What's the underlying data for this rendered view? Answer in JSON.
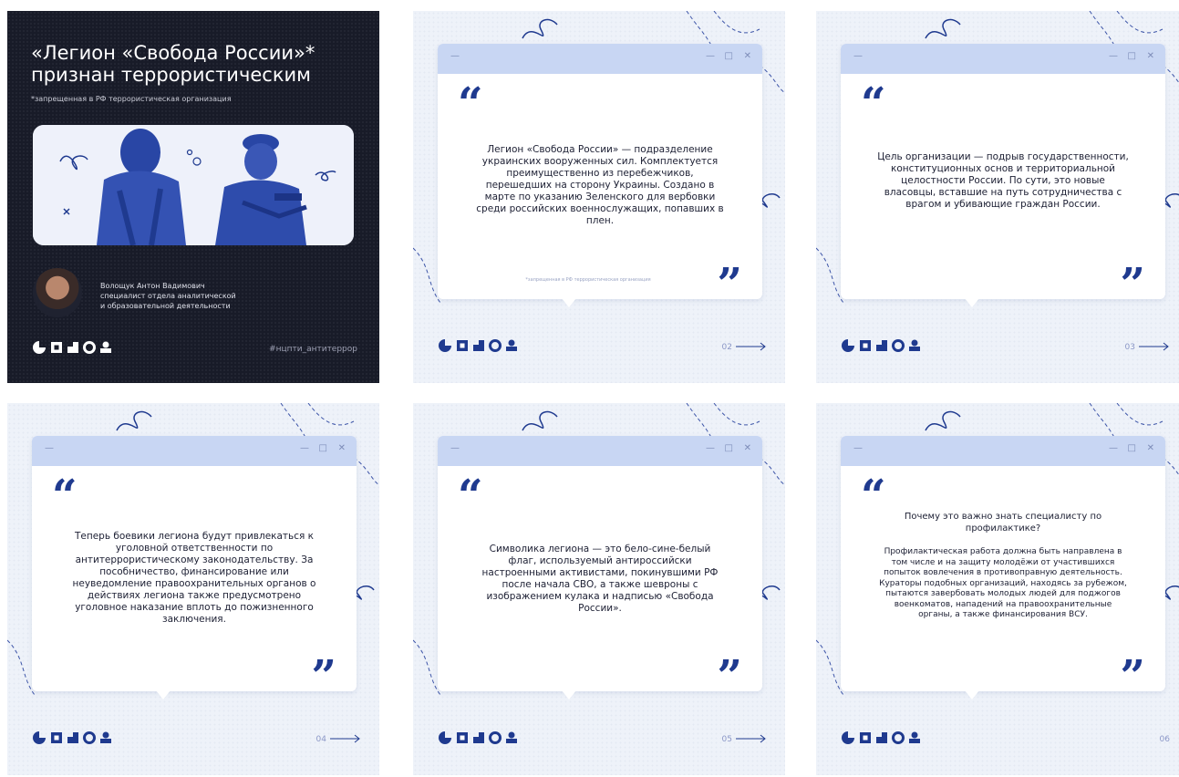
{
  "cover": {
    "title_line1": "«Легион «Свобода России»*",
    "title_line2": "признан террористическим",
    "footnote": "*запрещенная в РФ террористическая организация",
    "author_name": "Волощук Антон Вадимович",
    "author_role_line1": "специалист отдела аналитической",
    "author_role_line2": "и образовательной деятельности",
    "hashtag": "#нцпти_антитеррор"
  },
  "colors": {
    "accent": "#1f3a8f",
    "titlebar": "#c8d6f3",
    "cover_bg": "#181b28",
    "card_bg": "#eef2f9"
  },
  "window_controls": {
    "minimize": "—",
    "left_dash": "—",
    "maximize": "□",
    "close": "✕"
  },
  "quote_marks": {
    "open": "“",
    "close": "”"
  },
  "slides": [
    {
      "page": "02",
      "text": "Легион «Свобода России» — подразделение украинских вооруженных сил. Комплектуется преимущественно из перебежчиков, перешедших на сторону Украины. Создано в марте по указанию Зеленского для вербовки среди российских военнослужащих, попавших в плен.",
      "footnote": "*запрещенная в РФ террористическая организация"
    },
    {
      "page": "03",
      "text": "Цель организации — подрыв государственности, конституционных основ и территориальной целостности России. По сути, это новые власовцы, вставшие на путь сотрудничества с врагом и убивающие граждан России."
    },
    {
      "page": "04",
      "text": "Теперь боевики легиона будут привлекаться к уголовной ответственности по антитеррористическому законодательству. За пособничество, финансирование или неуведомление правоохранительных органов о действиях легиона также предусмотрено уголовное наказание вплоть до пожизненного заключения."
    },
    {
      "page": "05",
      "text": "Символика легиона — это бело-сине-белый флаг, используемый антироссийски настроенными активистами, покинувшими РФ после начала СВО, а также шевроны с изображением кулака и надписью «Свобода России»."
    },
    {
      "page": "06",
      "heading": "Почему это важно знать специалисту по профилактике?",
      "text": "Профилактическая работа должна быть направлена в том числе и на защиту молодёжи от участившихся попыток вовлечения в противоправную деятельность. Кураторы подобных организаций, находясь за рубежом, пытаются завербовать молодых людей для поджогов военкоматов, нападений на правоохранительные органы, а также финансирования ВСУ."
    }
  ]
}
